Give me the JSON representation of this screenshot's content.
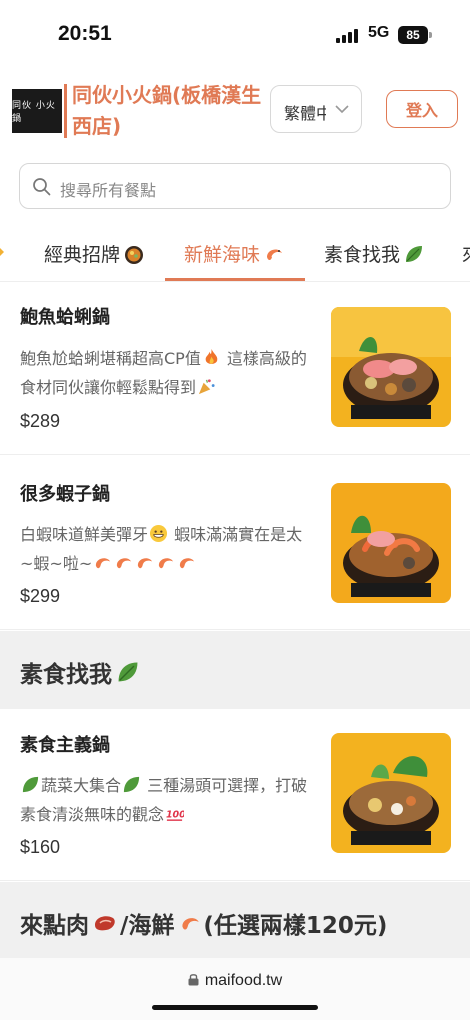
{
  "status_bar": {
    "time": "20:51",
    "network": "5G",
    "battery": "85"
  },
  "header": {
    "logo_text": "同伙 小火鍋",
    "store_title": "同伙小火鍋(板橋漢生西店)",
    "language": "繁體中文",
    "login_label": "登入"
  },
  "search": {
    "placeholder": "搜尋所有餐點"
  },
  "tabs": [
    {
      "label": "經典招牌",
      "icon": "hotpot-icon"
    },
    {
      "label": "新鮮海味",
      "icon": "shrimp-icon",
      "active": true
    },
    {
      "label": "素食找我",
      "icon": "leafy-green-icon"
    },
    {
      "label": "來",
      "icon": ""
    }
  ],
  "items": [
    {
      "name": "鮑魚蛤蜊鍋",
      "desc_1": "鮑魚尬蛤蜊堪稱超高CP值",
      "desc_2": " 這樣高級的食材同伙讓你輕鬆點得到",
      "price": "$289"
    },
    {
      "name": "很多蝦子鍋",
      "desc_1": "白蝦味道鮮美彈牙",
      "desc_2": " 蝦味滿滿實在是太~蝦~啦~",
      "price": "$299"
    },
    {
      "name": "素食主義鍋",
      "desc_1": "蔬菜大集合",
      "desc_2": " 三種湯頭可選擇，打破素食清淡無味的觀念",
      "price": "$160"
    }
  ],
  "sections": [
    {
      "title": "素食找我"
    },
    {
      "title_1": "來點肉",
      "title_2": "/海鮮",
      "title_3": "(任選兩樣120元)"
    }
  ],
  "browser": {
    "url": "maifood.tw"
  },
  "colors": {
    "accent": "#e07a55",
    "section_bg": "#f0f0f0",
    "text": "#222222"
  }
}
